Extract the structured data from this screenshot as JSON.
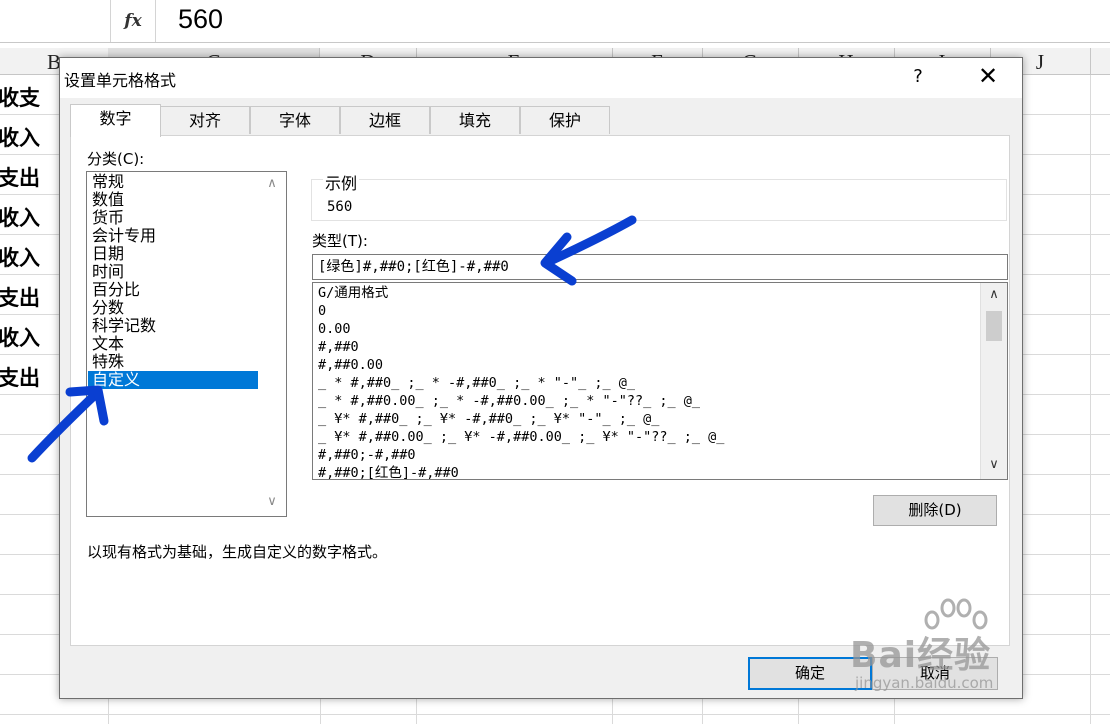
{
  "formula_bar": {
    "fx_label": "fx",
    "value": "560"
  },
  "columns": [
    "B",
    "C",
    "D",
    "E",
    "F",
    "G",
    "H",
    "I",
    "J"
  ],
  "column_b_cells": [
    "收支",
    "收入",
    "支出",
    "收入",
    "收入",
    "支出",
    "收入",
    "支出"
  ],
  "dialog": {
    "title": "设置单元格格式",
    "help": "?",
    "close": "✕",
    "tabs": [
      "数字",
      "对齐",
      "字体",
      "边框",
      "填充",
      "保护"
    ],
    "category_label": "分类(C):",
    "categories": [
      "常规",
      "数值",
      "货币",
      "会计专用",
      "日期",
      "时间",
      "百分比",
      "分数",
      "科学记数",
      "文本",
      "特殊",
      "自定义"
    ],
    "selected_category": "自定义",
    "sample_label": "示例",
    "sample_value": "560",
    "type_label": "类型(T):",
    "type_value": "[绿色]#,##0;[红色]-#,##0",
    "formats": [
      "G/通用格式",
      "0",
      "0.00",
      "#,##0",
      "#,##0.00",
      "_ * #,##0_ ;_ * -#,##0_ ;_ * \"-\"_ ;_ @_",
      "_ * #,##0.00_ ;_ * -#,##0.00_ ;_ * \"-\"??_ ;_ @_",
      "_ ¥* #,##0_ ;_ ¥* -#,##0_ ;_ ¥* \"-\"_ ;_ @_",
      "_ ¥* #,##0.00_ ;_ ¥* -#,##0.00_ ;_ ¥* \"-\"??_ ;_ @_",
      "#,##0;-#,##0",
      "#,##0;[红色]-#,##0"
    ],
    "delete_button": "删除(D)",
    "description": "以现有格式为基础，生成自定义的数字格式。",
    "ok_button": "确定",
    "cancel_button": "取消"
  },
  "annotation_color": "#0a3fd1",
  "watermark": {
    "brand": "Bai经验",
    "url": "jingyan.baidu.com"
  }
}
